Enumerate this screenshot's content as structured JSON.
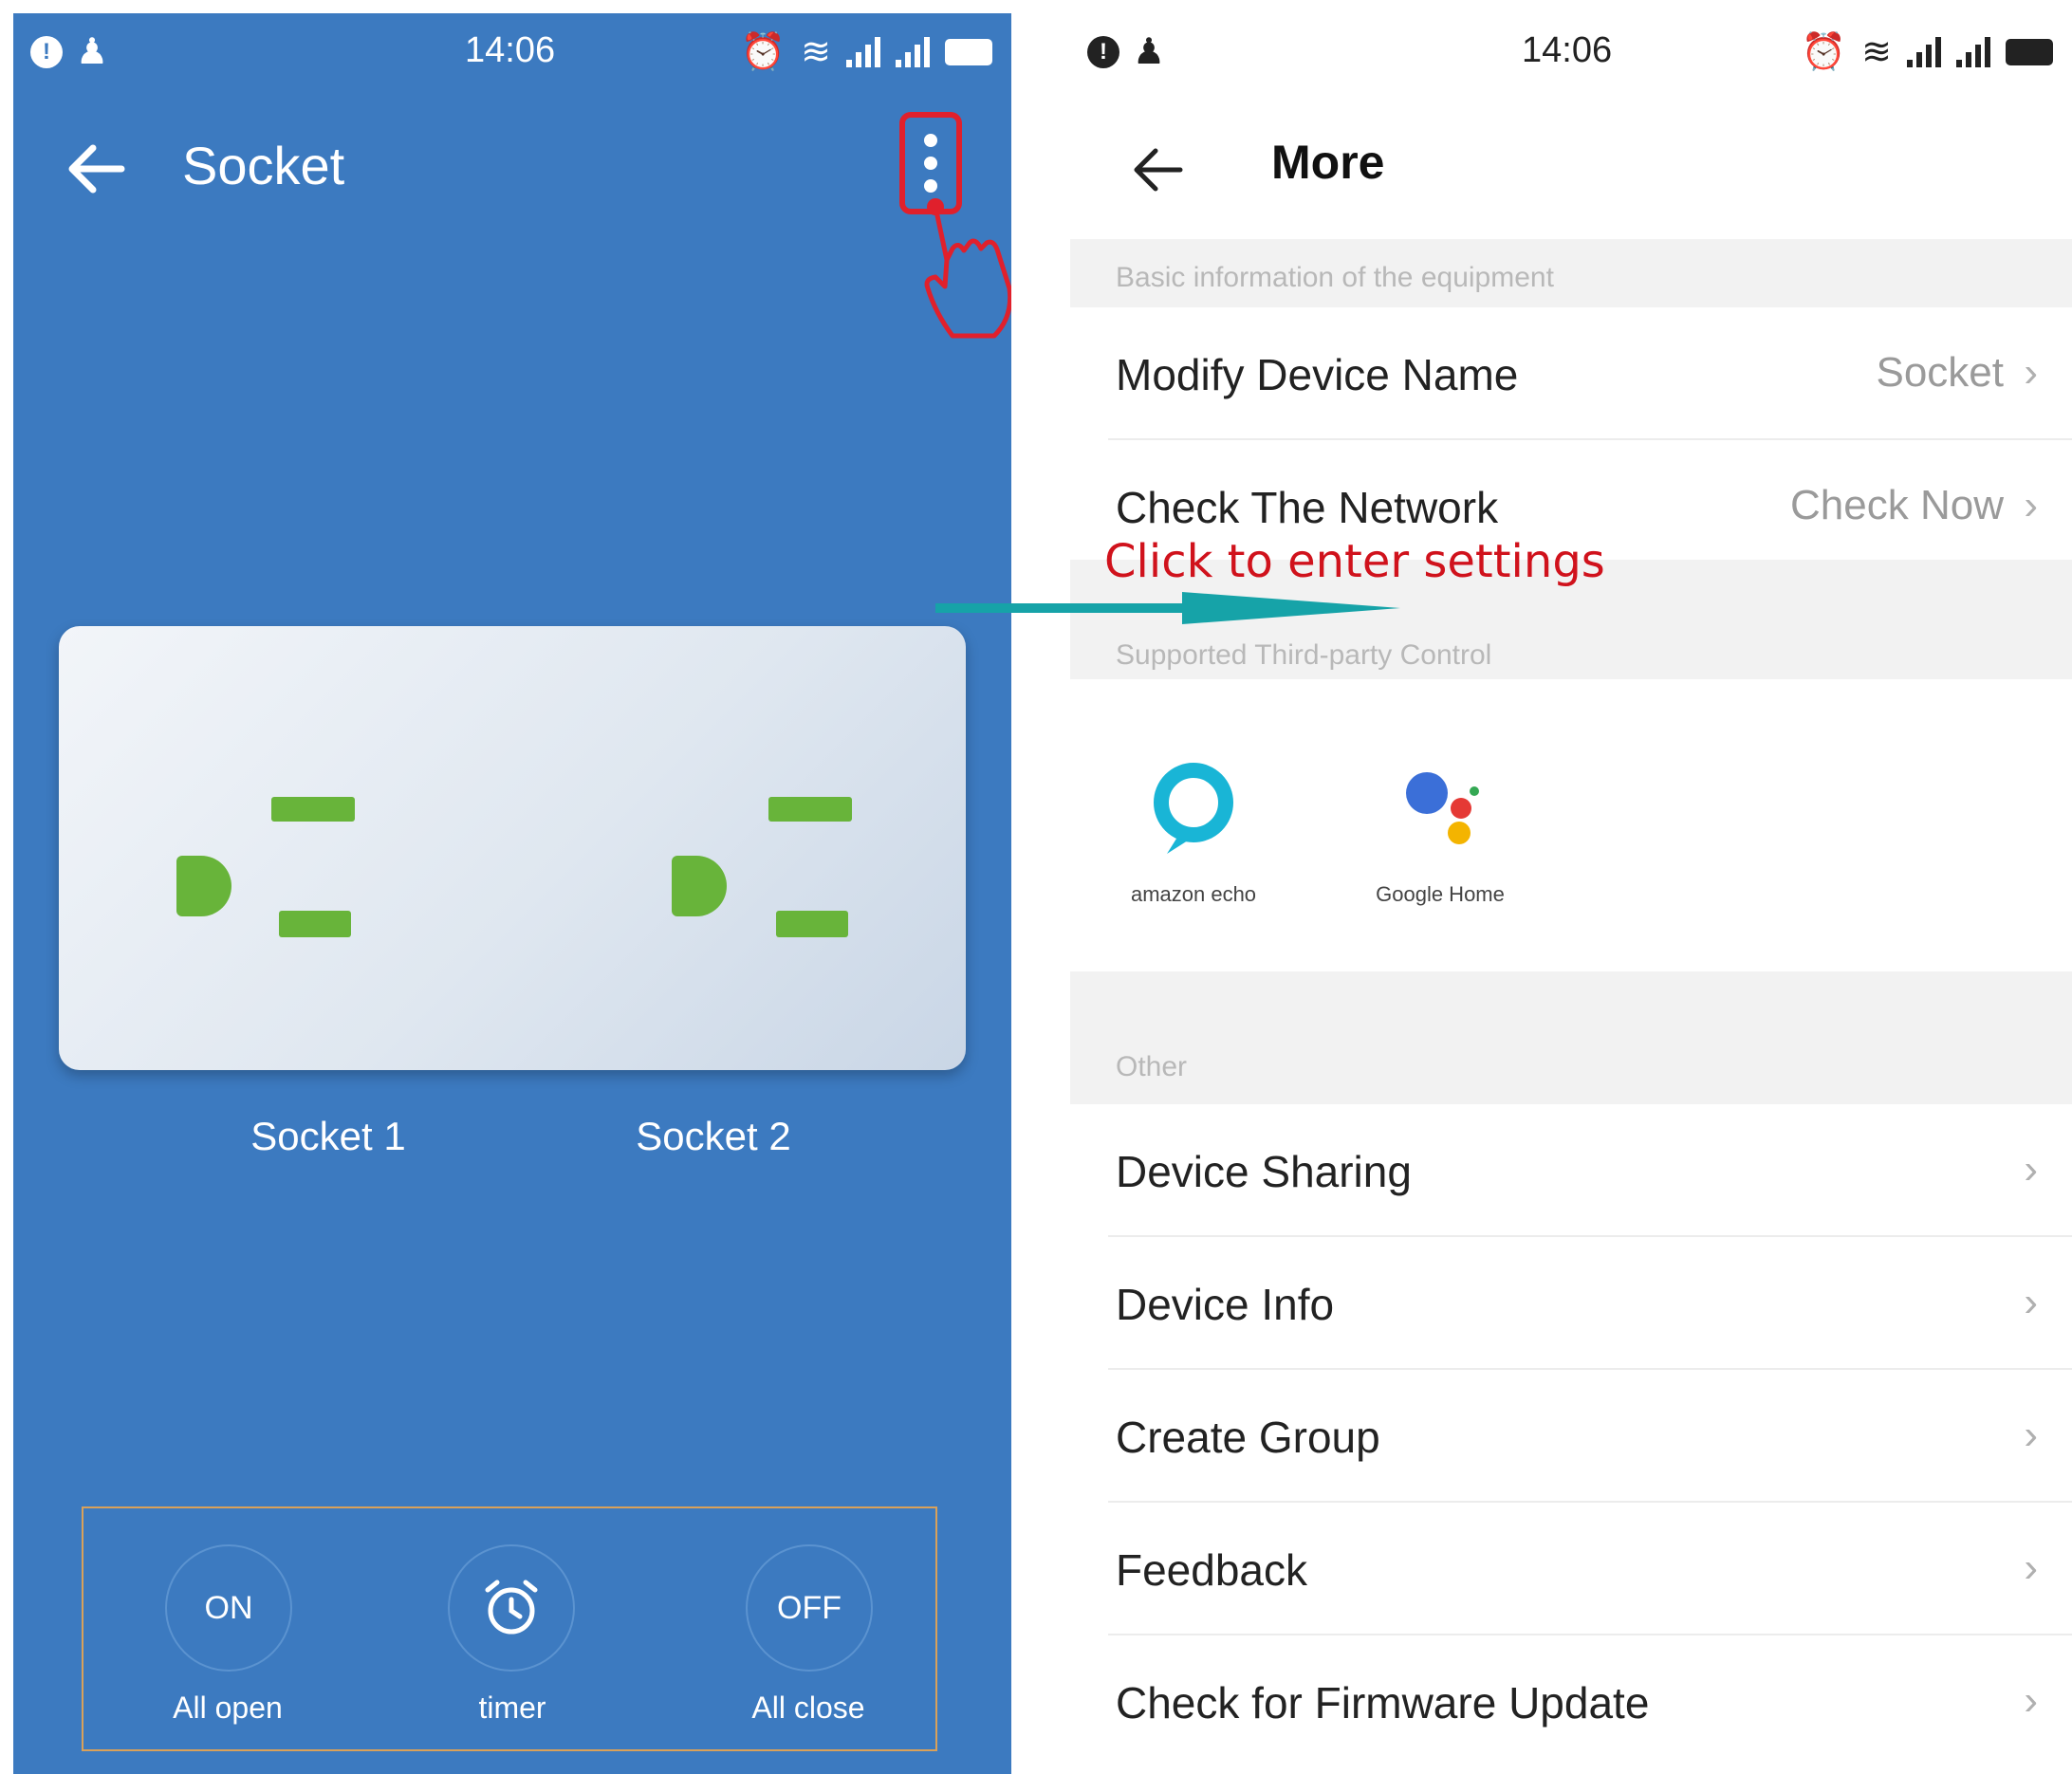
{
  "status_bar": {
    "time": "14:06"
  },
  "left_screen": {
    "title": "Socket",
    "sockets": [
      "Socket 1",
      "Socket 2"
    ],
    "controls": [
      {
        "icon_text": "ON",
        "label": "All open"
      },
      {
        "icon": "alarm-clock-icon",
        "label": "timer"
      },
      {
        "icon_text": "OFF",
        "label": "All close"
      }
    ]
  },
  "annotation": {
    "text": "Click to enter settings",
    "color": "#d0121c",
    "arrow_color": "#16a3a8"
  },
  "right_screen": {
    "title": "More",
    "section_basic": "Basic information of the equipment",
    "basic_rows": [
      {
        "label": "Modify Device Name",
        "value": "Socket"
      },
      {
        "label": "Check The Network",
        "value": "Check Now"
      }
    ],
    "section_third_party": "Supported Third-party Control",
    "third_party": [
      "amazon echo",
      "Google Home"
    ],
    "section_other": "Other",
    "other_rows": [
      "Device Sharing",
      "Device Info",
      "Create Group",
      "Feedback",
      "Check for Firmware Update"
    ]
  },
  "colors": {
    "accent": "#3c7ac0",
    "highlight": "#e0202c",
    "socket_green": "#68b43a"
  }
}
